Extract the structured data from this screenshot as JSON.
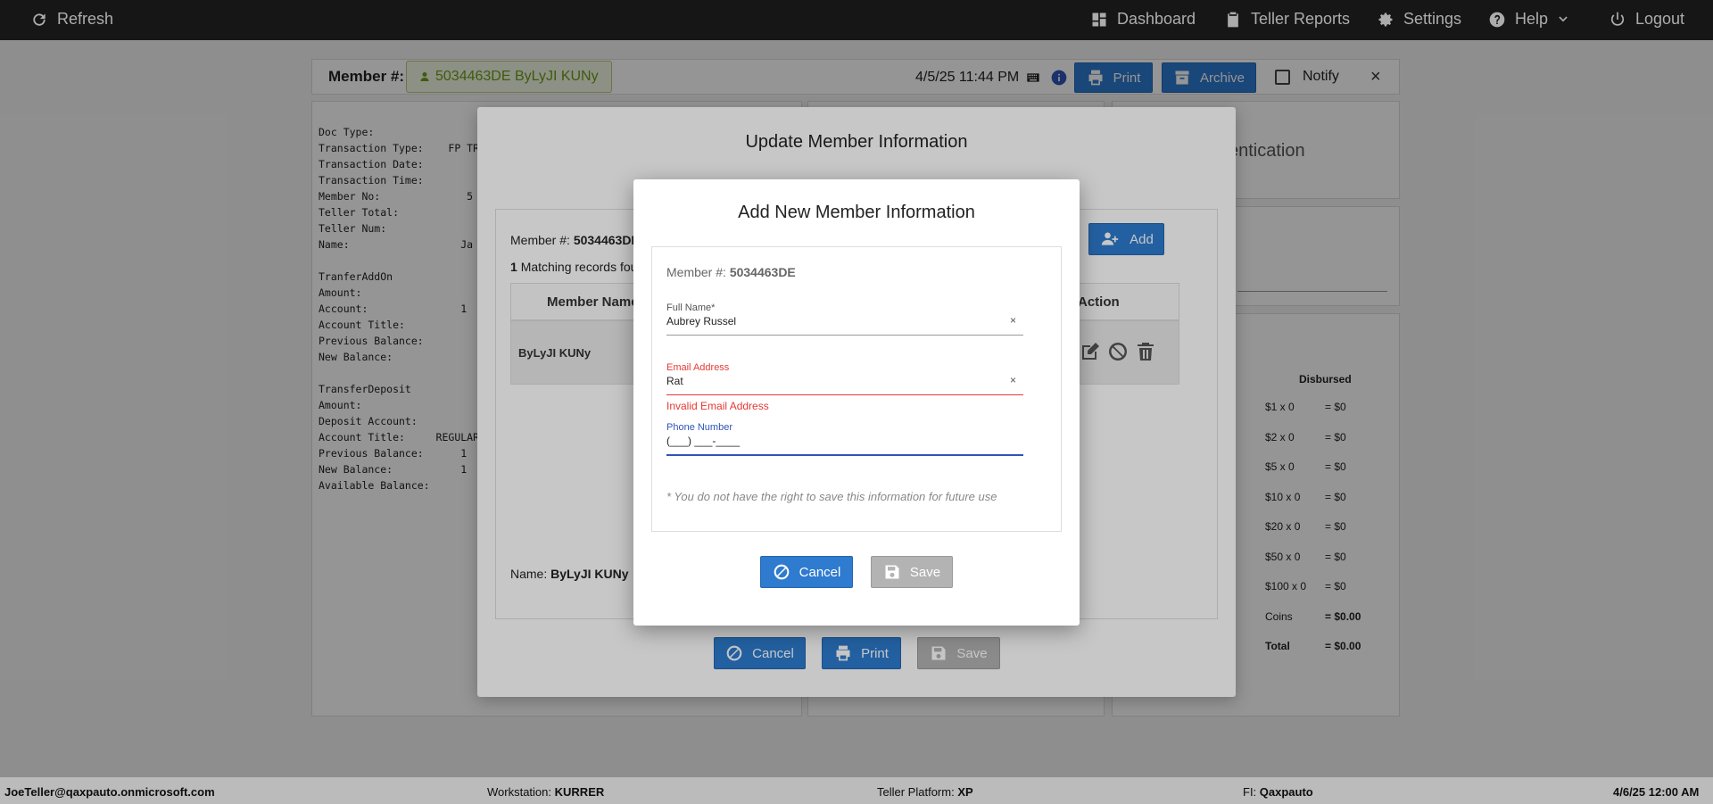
{
  "topbar": {
    "refresh": "Refresh",
    "dashboard": "Dashboard",
    "teller_reports": "Teller Reports",
    "settings": "Settings",
    "help": "Help",
    "logout": "Logout"
  },
  "header": {
    "member_label": "Member #:",
    "member_value": "5034463DE ByLyJI KUNy",
    "datetime": "4/5/25 11:44 PM",
    "print": "Print",
    "archive": "Archive",
    "notify": "Notify",
    "close": "×"
  },
  "receipt": {
    "lines": [
      "Doc Type:",
      "Transaction Type:    FP TRA",
      "Transaction Date:",
      "Transaction Time:",
      "Member No:              5",
      "Teller Total:",
      "Teller Num:",
      "Name:                  Ja",
      "",
      "TranferAddOn",
      "Amount:",
      "Account:               1",
      "Account Title:",
      "Previous Balance:",
      "New Balance:",
      "",
      "TransferDeposit",
      "Amount:",
      "Deposit Account:",
      "Account Title:     REGULAR",
      "Previous Balance:      1",
      "New Balance:           1",
      "Available Balance:"
    ]
  },
  "right_panel": {
    "auth_partial": "entication",
    "disbursed_header": "Disbursed",
    "rows": [
      {
        "denom": "$1 x 0",
        "value": "= $0"
      },
      {
        "denom": "$2 x 0",
        "value": "= $0"
      },
      {
        "denom": "$5 x 0",
        "value": "= $0"
      },
      {
        "denom": "$10 x 0",
        "value": "= $0"
      },
      {
        "denom": "$20 x 0",
        "value": "= $0"
      },
      {
        "denom": "$50 x 0",
        "value": "= $0"
      },
      {
        "denom": "$100 x 0",
        "value": "= $0"
      },
      {
        "denom": "Coins",
        "value": "= $0.00"
      },
      {
        "denom": "Total",
        "value": "= $0.00"
      }
    ]
  },
  "outer_modal": {
    "title": "Update Member Information",
    "member_label": "Member #:",
    "member_value": "5034463DE",
    "matching_count": "1",
    "matching_text": "Matching records fou",
    "add": "Add",
    "col_member_name": "Member Name",
    "col_action": "Action",
    "row_name": "ByLyJI KUNy",
    "name_label": "Name:",
    "name_value": "ByLyJI KUNy",
    "cancel": "Cancel",
    "print": "Print",
    "save": "Save"
  },
  "inner_modal": {
    "title": "Add New Member Information",
    "member_label": "Member #:",
    "member_value": "5034463DE",
    "full_name_label": "Full Name*",
    "full_name_value": "Aubrey Russel",
    "email_label": "Email Address",
    "email_value": "Rat",
    "email_error": "Invalid Email Address",
    "phone_label": "Phone Number",
    "phone_value": "(___) ___-____",
    "clear": "×",
    "disclaimer": "* You do not have the right to save this information for future use",
    "cancel": "Cancel",
    "save": "Save"
  },
  "footer": {
    "user": "JoeTeller@qaxpauto.onmicrosoft.com",
    "workstation_label": "Workstation:",
    "workstation_value": "KURRER",
    "platform_label": "Teller Platform:",
    "platform_value": "XP",
    "fi_label": "FI:",
    "fi_value": "Qaxpauto",
    "datetime": "4/6/25 12:00 AM"
  }
}
